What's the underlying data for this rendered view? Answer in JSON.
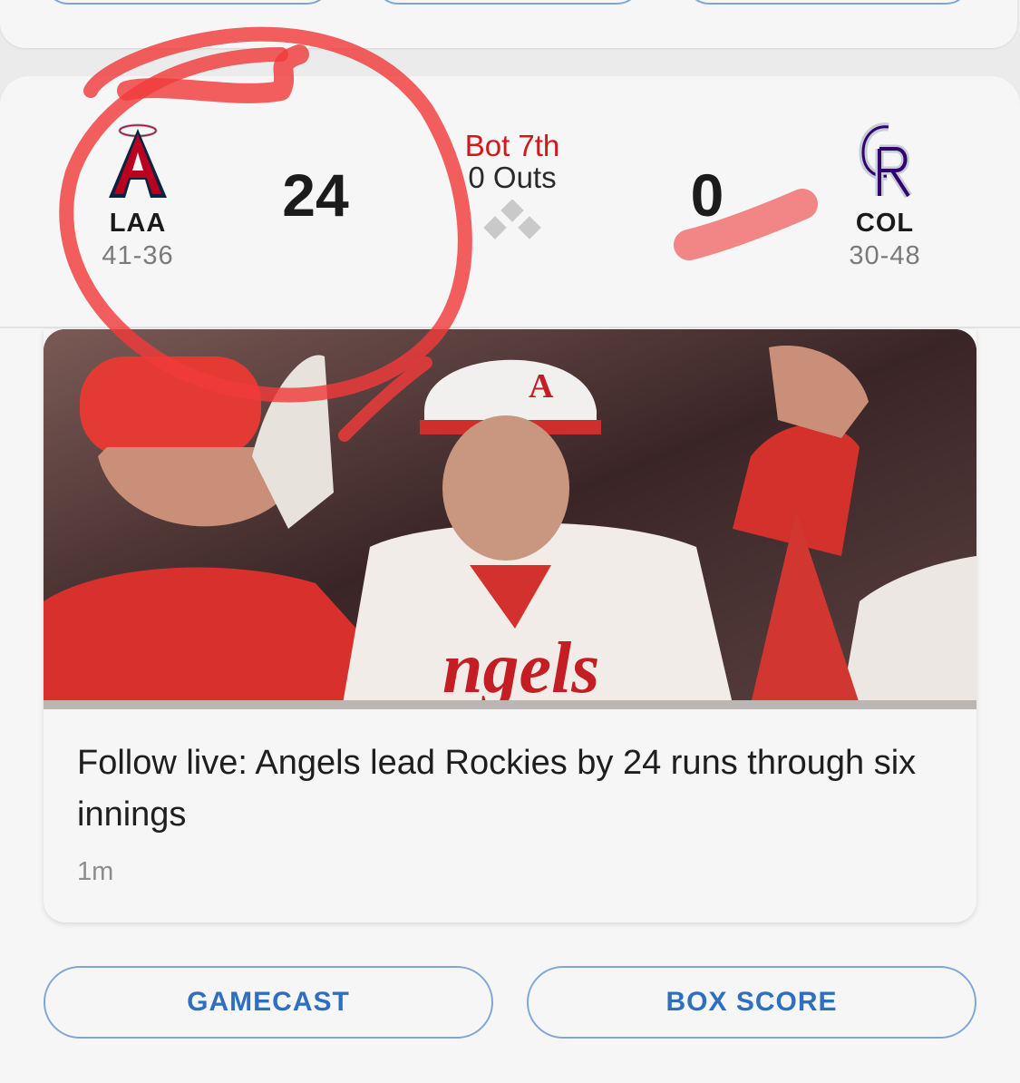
{
  "prev_card": {
    "buttons": [
      "",
      "",
      ""
    ]
  },
  "game": {
    "home": {
      "abbr": "LAA",
      "record": "41-36",
      "score": "24",
      "logo_icon": "angels-logo-icon",
      "color": "#ba0021"
    },
    "away": {
      "abbr": "COL",
      "record": "30-48",
      "score": "0",
      "logo_icon": "rockies-logo-icon",
      "color": "#33006f"
    },
    "status": {
      "inning": "Bot 7th",
      "outs": "0 Outs",
      "bases_icon": "base-diamond-icon"
    }
  },
  "article": {
    "headline": "Follow live: Angels lead Rockies by 24 runs through six innings",
    "timestamp": "1m"
  },
  "actions": {
    "gamecast_label": "GAMECAST",
    "boxscore_label": "BOX SCORE"
  },
  "colors": {
    "accent": "#2f6fc0",
    "button_border": "#7fa6d8",
    "live_red": "#d0171b",
    "annotation_red": "#f03a3a"
  }
}
